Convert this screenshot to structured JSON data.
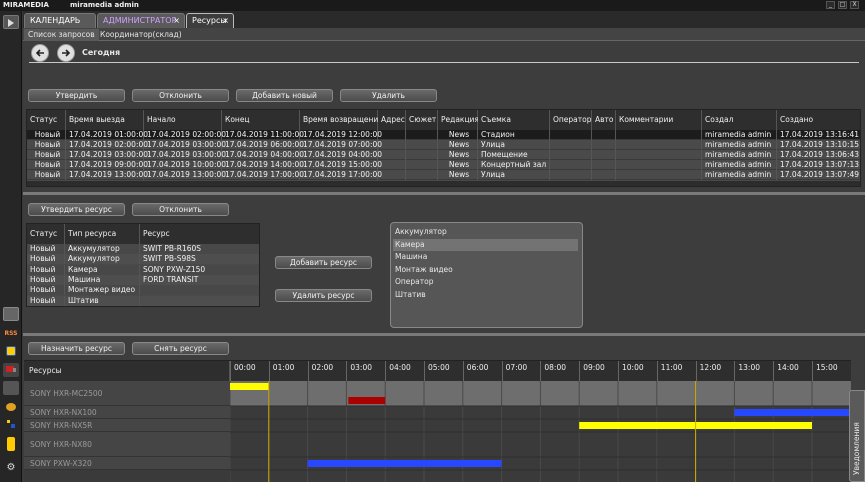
{
  "app": {
    "logo": "MIRAMEDIA",
    "user": "miramedia admin"
  },
  "window_controls": {
    "minimize": "_",
    "maximize": "□",
    "close": "X"
  },
  "tabs": [
    {
      "label": "КАЛЕНДАРЬ"
    },
    {
      "label": "АДМИНИСТРАТОР"
    },
    {
      "label": "Ресурсы",
      "close": "×"
    }
  ],
  "subtabs": [
    {
      "label": "Список запросов"
    },
    {
      "label": "Координатор(склад)"
    }
  ],
  "nav": {
    "today_label": "Сегодня"
  },
  "requests": {
    "buttons": {
      "approve": "Утвердить",
      "reject": "Отклонить",
      "add": "Добавить новый",
      "delete": "Удалить"
    },
    "columns": [
      "Статус",
      "Время выезда",
      "Начало",
      "Конец",
      "Время возвращения",
      "Адрес",
      "Сюжет",
      "Редакция",
      "Съемка",
      "Оператор",
      "Авто",
      "Комментарии",
      "Создал",
      "Создано"
    ],
    "rows": [
      [
        "Новый",
        "17.04.2019 01:00:00",
        "17.04.2019 02:00:00",
        "17.04.2019 11:00:00",
        "17.04.2019 12:00:00",
        "",
        "",
        "News",
        "Стадион",
        "",
        "",
        "",
        "miramedia admin",
        "17.04.2019 13:16:41"
      ],
      [
        "Новый",
        "17.04.2019 02:00:00",
        "17.04.2019 03:00:00",
        "17.04.2019 06:00:00",
        "17.04.2019 07:00:00",
        "",
        "",
        "News",
        "Улица",
        "",
        "",
        "",
        "miramedia admin",
        "17.04.2019 13:10:15"
      ],
      [
        "Новый",
        "17.04.2019 03:00:00",
        "17.04.2019 03:00:00",
        "17.04.2019 04:00:00",
        "17.04.2019 04:00:00",
        "",
        "",
        "News",
        "Помещение",
        "",
        "",
        "",
        "miramedia admin",
        "17.04.2019 13:06:43"
      ],
      [
        "Новый",
        "17.04.2019 09:00:00",
        "17.04.2019 10:00:00",
        "17.04.2019 14:00:00",
        "17.04.2019 15:00:00",
        "",
        "",
        "News",
        "Концертный зал",
        "",
        "",
        "",
        "miramedia admin",
        "17.04.2019 13:07:13"
      ],
      [
        "Новый",
        "17.04.2019 13:00:00",
        "17.04.2019 13:00:00",
        "17.04.2019 17:00:00",
        "17.04.2019 17:00:00",
        "",
        "",
        "News",
        "Улица",
        "",
        "",
        "",
        "miramedia admin",
        "17.04.2019 13:07:49"
      ]
    ]
  },
  "resources": {
    "buttons": {
      "approve": "Утвердить ресурс",
      "reject": "Отклонить",
      "add": "Добавить ресурс",
      "delete": "Удалить ресурс"
    },
    "columns": [
      "Статус",
      "Тип ресурса",
      "Ресурс"
    ],
    "rows": [
      [
        "Новый",
        "Аккумулятор",
        "SWIT PB-R160S"
      ],
      [
        "Новый",
        "Аккумулятор",
        "SWIT PB-S98S"
      ],
      [
        "Новый",
        "Камера",
        "SONY PXW-Z150"
      ],
      [
        "Новый",
        "Машина",
        "FORD TRANSIT"
      ],
      [
        "Новый",
        "Монтажер видео",
        ""
      ],
      [
        "Новый",
        "Штатив",
        ""
      ]
    ],
    "types": [
      "Аккумулятор",
      "Камера",
      "Машина",
      "Монтаж видео",
      "Оператор",
      "Штатив"
    ]
  },
  "schedule": {
    "buttons": {
      "assign": "Назначить ресурс",
      "remove": "Снять ресурс"
    },
    "resources_header": "Ресурсы",
    "hours": [
      "00:00",
      "01:00",
      "02:00",
      "03:00",
      "04:00",
      "05:00",
      "06:00",
      "07:00",
      "08:00",
      "09:00",
      "10:00",
      "11:00",
      "12:00",
      "13:00",
      "14:00",
      "15:00"
    ],
    "resources": [
      "SONY HXR-MC2500",
      "SONY HXR-NX100",
      "SONY HXR-NX5R",
      "SONY HXR-NX80",
      "SONY PXW-X320"
    ],
    "bars": [
      {
        "resource": 0,
        "start": 0.0,
        "end": 1.0,
        "color": "#ffff00"
      },
      {
        "resource": 0,
        "start": 3.05,
        "end": 4.0,
        "color": "#aa0000"
      },
      {
        "resource": 1,
        "start": 13.0,
        "end": 16.0,
        "color": "#2848ff"
      },
      {
        "resource": 2,
        "start": 9.0,
        "end": 15.0,
        "color": "#ffff00"
      },
      {
        "resource": 4,
        "start": 2.0,
        "end": 7.0,
        "color": "#2848ff"
      }
    ],
    "markers": [
      1.0,
      12.0
    ]
  },
  "notifications_label": "Уведомления",
  "side_icons": {
    "rss": "RSS"
  },
  "colors": {
    "selected_row": "#1c1c1c",
    "accent_tab": "#d0a0ff"
  }
}
